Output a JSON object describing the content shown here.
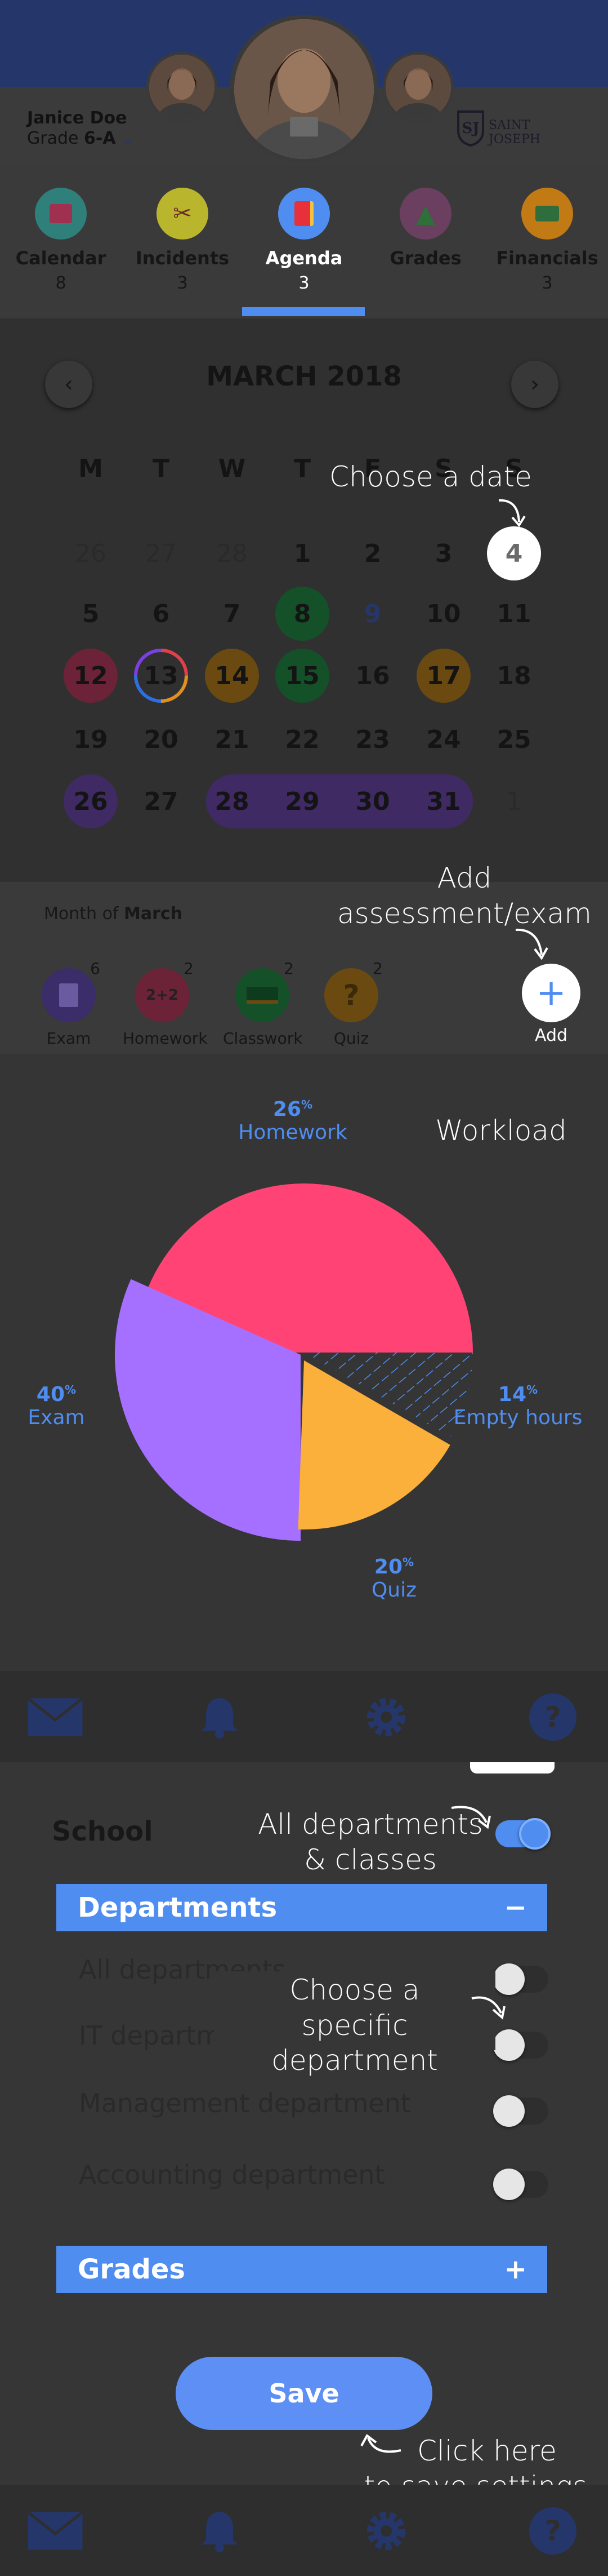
{
  "header": {
    "student_name": "Janice Doe",
    "grade_prefix": "Grade ",
    "grade_value": "6-A",
    "school_name": "SAINT JOSEPH"
  },
  "tabs": [
    {
      "label": "Calendar",
      "count": "8",
      "icon": "calendar-icon",
      "color": "#2f7f7a"
    },
    {
      "label": "Incidents",
      "count": "3",
      "icon": "paperclip-icon",
      "color": "#b9b52c"
    },
    {
      "label": "Agenda",
      "count": "3",
      "icon": "book-icon",
      "color": "#4f8df0"
    },
    {
      "label": "Grades",
      "count": "",
      "icon": "shapes-icon",
      "color": "#6a3f5f"
    },
    {
      "label": "Financials",
      "count": "3",
      "icon": "money-icon",
      "color": "#c27a15"
    }
  ],
  "calendar": {
    "month_title": "MARCH 2018",
    "weekdays": [
      "M",
      "T",
      "W",
      "T",
      "F",
      "S",
      "S"
    ],
    "weeks": [
      [
        "26",
        "27",
        "28",
        "1",
        "2",
        "3",
        "4"
      ],
      [
        "5",
        "6",
        "7",
        "8",
        "9",
        "10",
        "11"
      ],
      [
        "12",
        "13",
        "14",
        "15",
        "16",
        "17",
        "18"
      ],
      [
        "19",
        "20",
        "21",
        "22",
        "23",
        "24",
        "25"
      ],
      [
        "26",
        "27",
        "28",
        "29",
        "30",
        "31",
        "1"
      ]
    ],
    "selected_day": "4"
  },
  "annotations": {
    "choose_date": "Choose a date",
    "add_assessment_line1": "Add",
    "add_assessment_line2": "assessment/exam",
    "workload": "Workload",
    "all_departments_line1": "All departments",
    "all_departments_line2": "& classes",
    "choose_dept_line1": "Choose a",
    "choose_dept_line2": "specific department",
    "save_hint_line1": "Click here",
    "save_hint_line2": "to save settings"
  },
  "summary": {
    "month_of_prefix": "Month of ",
    "month_of_value": "March",
    "categories": [
      {
        "label": "Exam",
        "count": "6",
        "icon": "exam-icon",
        "color": "#3b2d6a"
      },
      {
        "label": "Homework",
        "count": "2",
        "icon": "homework-icon",
        "color": "#6c2338"
      },
      {
        "label": "Classwork",
        "count": "2",
        "icon": "classwork-icon",
        "color": "#155128"
      },
      {
        "label": "Quiz",
        "count": "2",
        "icon": "quiz-icon",
        "color": "#6a4a10"
      }
    ],
    "add_label": "Add"
  },
  "chart_data": {
    "type": "pie",
    "title": "Workload",
    "slices": [
      {
        "label": "Homework",
        "value": 26,
        "color": "#ff4475"
      },
      {
        "label": "Exam",
        "value": 40,
        "color": "#a570ff"
      },
      {
        "label": "Quiz",
        "value": 20,
        "color": "#fbb03b"
      },
      {
        "label": "Empty hours",
        "value": 14,
        "color": "#4f8df0"
      }
    ],
    "unit": "%"
  },
  "settings": {
    "school_title": "School",
    "departments_header": "Departments",
    "departments_toggle_symbol": "−",
    "departments": [
      "All departments",
      "IT department",
      "Management department",
      "Accounting department"
    ],
    "grades_header": "Grades",
    "grades_toggle_symbol": "+",
    "save_label": "Save"
  },
  "colors": {
    "accent": "#4f8df0",
    "header_band": "#25376a"
  }
}
